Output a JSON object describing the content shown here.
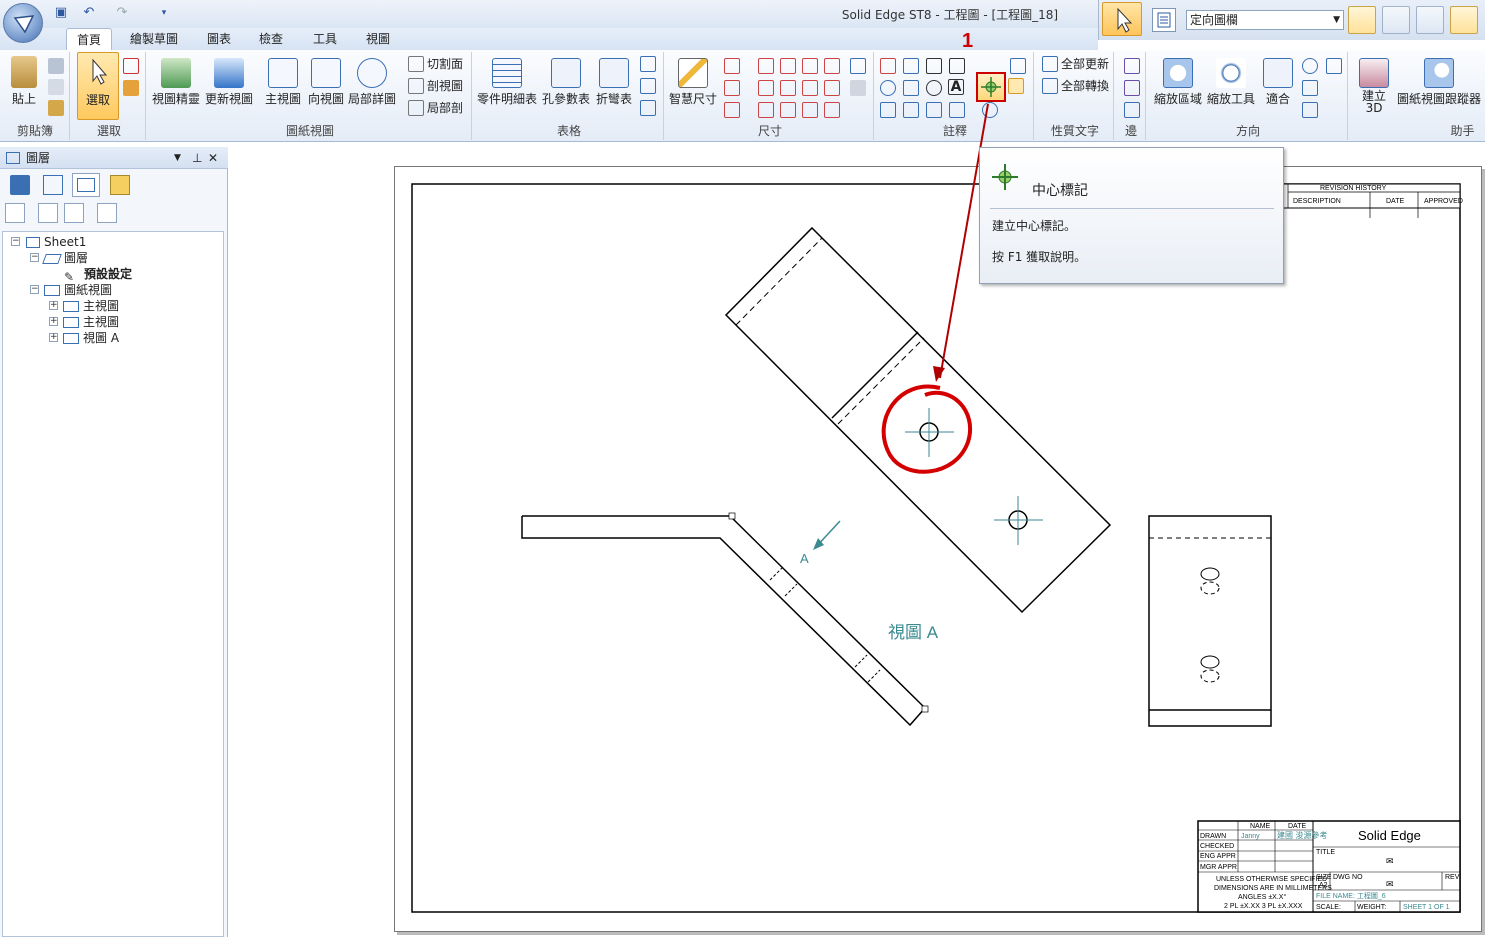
{
  "app": {
    "title": "Solid Edge ST8 - 工程圖 - [工程圖_18]"
  },
  "right_toolbar": {
    "combo_value": "定向圖欄"
  },
  "tabs": [
    "首頁",
    "繪製草圖",
    "圖表",
    "檢查",
    "工具",
    "視圖"
  ],
  "ribbon": {
    "clipboard": {
      "label": "剪貼簿",
      "paste": "貼上"
    },
    "select": {
      "label": "選取",
      "select": "選取"
    },
    "drawing_views": {
      "label": "圖紙視圖",
      "view_wizard": "視圖精靈",
      "update_views": "更新視圖",
      "principal": "主視圖",
      "auxiliary": "向視圖",
      "detail": "局部詳圖",
      "cutting_plane": "切割面",
      "section": "剖視圖",
      "broken_out": "局部剖"
    },
    "tables": {
      "label": "表格",
      "parts_list": "零件明細表",
      "hole_table": "孔參數表",
      "bend_table": "折彎表"
    },
    "dimension": {
      "label": "尺寸",
      "smart_dimension": "智慧尺寸"
    },
    "annotation": {
      "label": "註釋"
    },
    "property_text": {
      "label": "性質文字",
      "update_all": "全部更新",
      "convert_all": "全部轉換"
    },
    "edges": {
      "label": "邊"
    },
    "orient": {
      "label": "方向",
      "zoom_area": "縮放區域",
      "zoom_tool": "縮放工具",
      "fit": "適合"
    },
    "assist": {
      "label": "助手",
      "create_3d": "建立\n3D",
      "tracker": "圖紙視圖跟蹤器"
    }
  },
  "panel": {
    "title": "圖層",
    "tree": [
      {
        "label": "Sheet1"
      },
      {
        "label": "圖層"
      },
      {
        "label": "預設設定"
      },
      {
        "label": "圖紙視圖"
      },
      {
        "label": "主視圖"
      },
      {
        "label": "主視圖"
      },
      {
        "label": "視圖 A"
      }
    ]
  },
  "annotation_marker": "1",
  "tooltip": {
    "title": "中心標記",
    "description": "建立中心標記。",
    "help": "按 F1 獲取說明。"
  },
  "drawing": {
    "view_label": "視圖 A",
    "arrow_label": "A",
    "revision": {
      "title": "REVISION HISTORY",
      "description": "DESCRIPTION",
      "date": "DATE",
      "approved": "APPROVED"
    },
    "title_block": {
      "name_col": "NAME",
      "date_col": "DATE",
      "drawn": "DRAWN",
      "drawn_name": "Janny",
      "drawn_date": "建國 浚源參考",
      "checked": "CHECKED",
      "eng_appr": "ENG APPR",
      "mgr_appr": "MGR APPR",
      "notes": [
        "UNLESS OTHERWISE SPECIFIED",
        "DIMENSIONS ARE IN MILLIMETERS",
        "ANGLES ±X.X°",
        "2 PL ±X.XX 3 PL ±X.XXX"
      ],
      "company": "Solid Edge",
      "title_label": "TITLE",
      "size_label": "SIZE",
      "size": "A2",
      "dwg_label": "DWG NO",
      "rev_label": "REV",
      "file_name": "FILE NAME: 工程圖_6",
      "scale": "SCALE:",
      "weight": "WEIGHT:",
      "sheet": "SHEET 1 OF 1"
    }
  }
}
